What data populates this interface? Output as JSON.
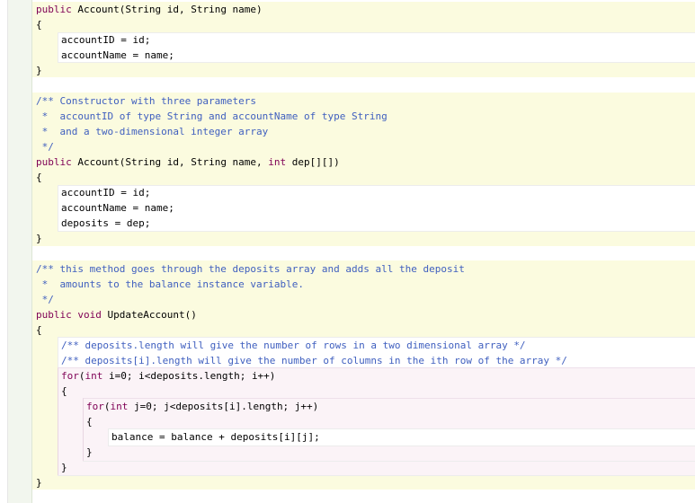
{
  "editor": {
    "lines": [
      {
        "kw": "public",
        "rest": " Account(String id, String name)"
      },
      {
        "text": "{"
      },
      {
        "text": "accountID = id;"
      },
      {
        "text": "accountName = name;"
      },
      {
        "text": "}"
      },
      {
        "comment": "/** Constructor with three parameters"
      },
      {
        "comment": " *  accountID of type String and accountName of type String"
      },
      {
        "comment": " *  and a two-dimensional integer array"
      },
      {
        "comment": " */"
      },
      {
        "kw": "public",
        "mid": " Account(String id, String name, ",
        "kw2": "int",
        "rest": " dep[][])"
      },
      {
        "text": "{"
      },
      {
        "text": "accountID = id;"
      },
      {
        "text": "accountName = name;"
      },
      {
        "text": "deposits = dep;"
      },
      {
        "text": "}"
      },
      {
        "comment": "/** this method goes through the deposits array and adds all the deposit"
      },
      {
        "comment": " *  amounts to the balance instance variable."
      },
      {
        "comment": " */"
      },
      {
        "kw": "public",
        "mid": " ",
        "kw2": "void",
        "rest": " UpdateAccount()"
      },
      {
        "text": "{"
      },
      {
        "comment": "/** deposits.length will give the number of rows in a two dimensional array */"
      },
      {
        "comment": "/** deposits[i].length will give the number of columns in the ith row of the array */"
      },
      {
        "kw": "for",
        "mid": "(",
        "kw2": "int",
        "rest": " i=0; i<deposits.length; i++)"
      },
      {
        "text": "{"
      },
      {
        "kw": "for",
        "mid": "(",
        "kw2": "int",
        "rest": " j=0; j<deposits[i].length; j++)"
      },
      {
        "text": "{"
      },
      {
        "text": "balance = balance + deposits[i][j];"
      },
      {
        "text": "}"
      },
      {
        "text": "}"
      },
      {
        "text": "}"
      }
    ]
  },
  "colors": {
    "keyword": "#7f0055",
    "comment": "#3f5fbf",
    "scope_method": "#fbfbdf",
    "scope_loop": "#fbf3f7"
  }
}
